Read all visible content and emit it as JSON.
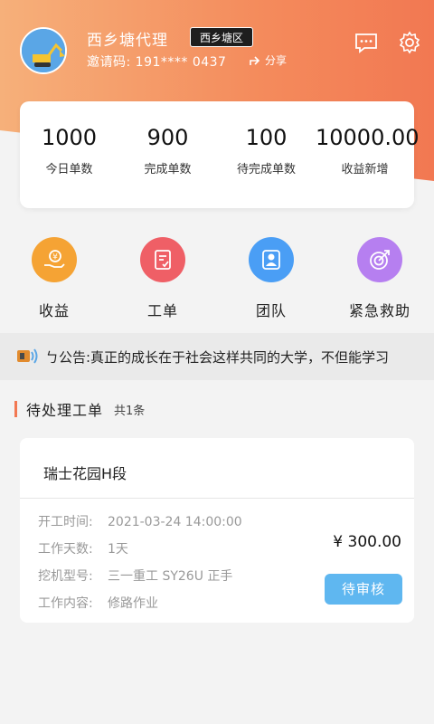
{
  "header": {
    "agent_name": "西乡塘代理",
    "region": "西乡塘区",
    "invite_text": "邀请码: 191**** 0437",
    "share_label": "分享",
    "message_icon": "message-icon",
    "settings_icon": "gear-icon"
  },
  "stats": [
    {
      "value": "1000",
      "label": "今日单数"
    },
    {
      "value": "900",
      "label": "完成单数"
    },
    {
      "value": "100",
      "label": "待完成单数"
    },
    {
      "value": "10000.00",
      "label": "收益新增"
    }
  ],
  "menu": [
    {
      "label": "收益",
      "icon": "income-icon",
      "color": "#f5a334"
    },
    {
      "label": "工单",
      "icon": "work-order-icon",
      "color": "#ef5f66"
    },
    {
      "label": "团队",
      "icon": "team-icon",
      "color": "#4a9ef5"
    },
    {
      "label": "紧急救助",
      "icon": "emergency-icon",
      "color": "#b67ff0"
    }
  ],
  "notice": {
    "text": "ㄅ公告:真正的成长在于社会这样共同的大学，不但能学习"
  },
  "pending_section": {
    "title": "待处理工单",
    "count": "共1条"
  },
  "order": {
    "title": "瑞士花园H段",
    "rows": [
      {
        "key": "开工时间:",
        "value": "2021-03-24 14:00:00"
      },
      {
        "key": "工作天数:",
        "value": "1天"
      },
      {
        "key": "挖机型号:",
        "value": "三一重工 SY26U 正手"
      },
      {
        "key": "工作内容:",
        "value": "修路作业"
      }
    ],
    "price": "¥ 300.00",
    "status": "待审核"
  },
  "colors": {
    "accent": "#f27852",
    "status_button": "#5fb7f0"
  }
}
